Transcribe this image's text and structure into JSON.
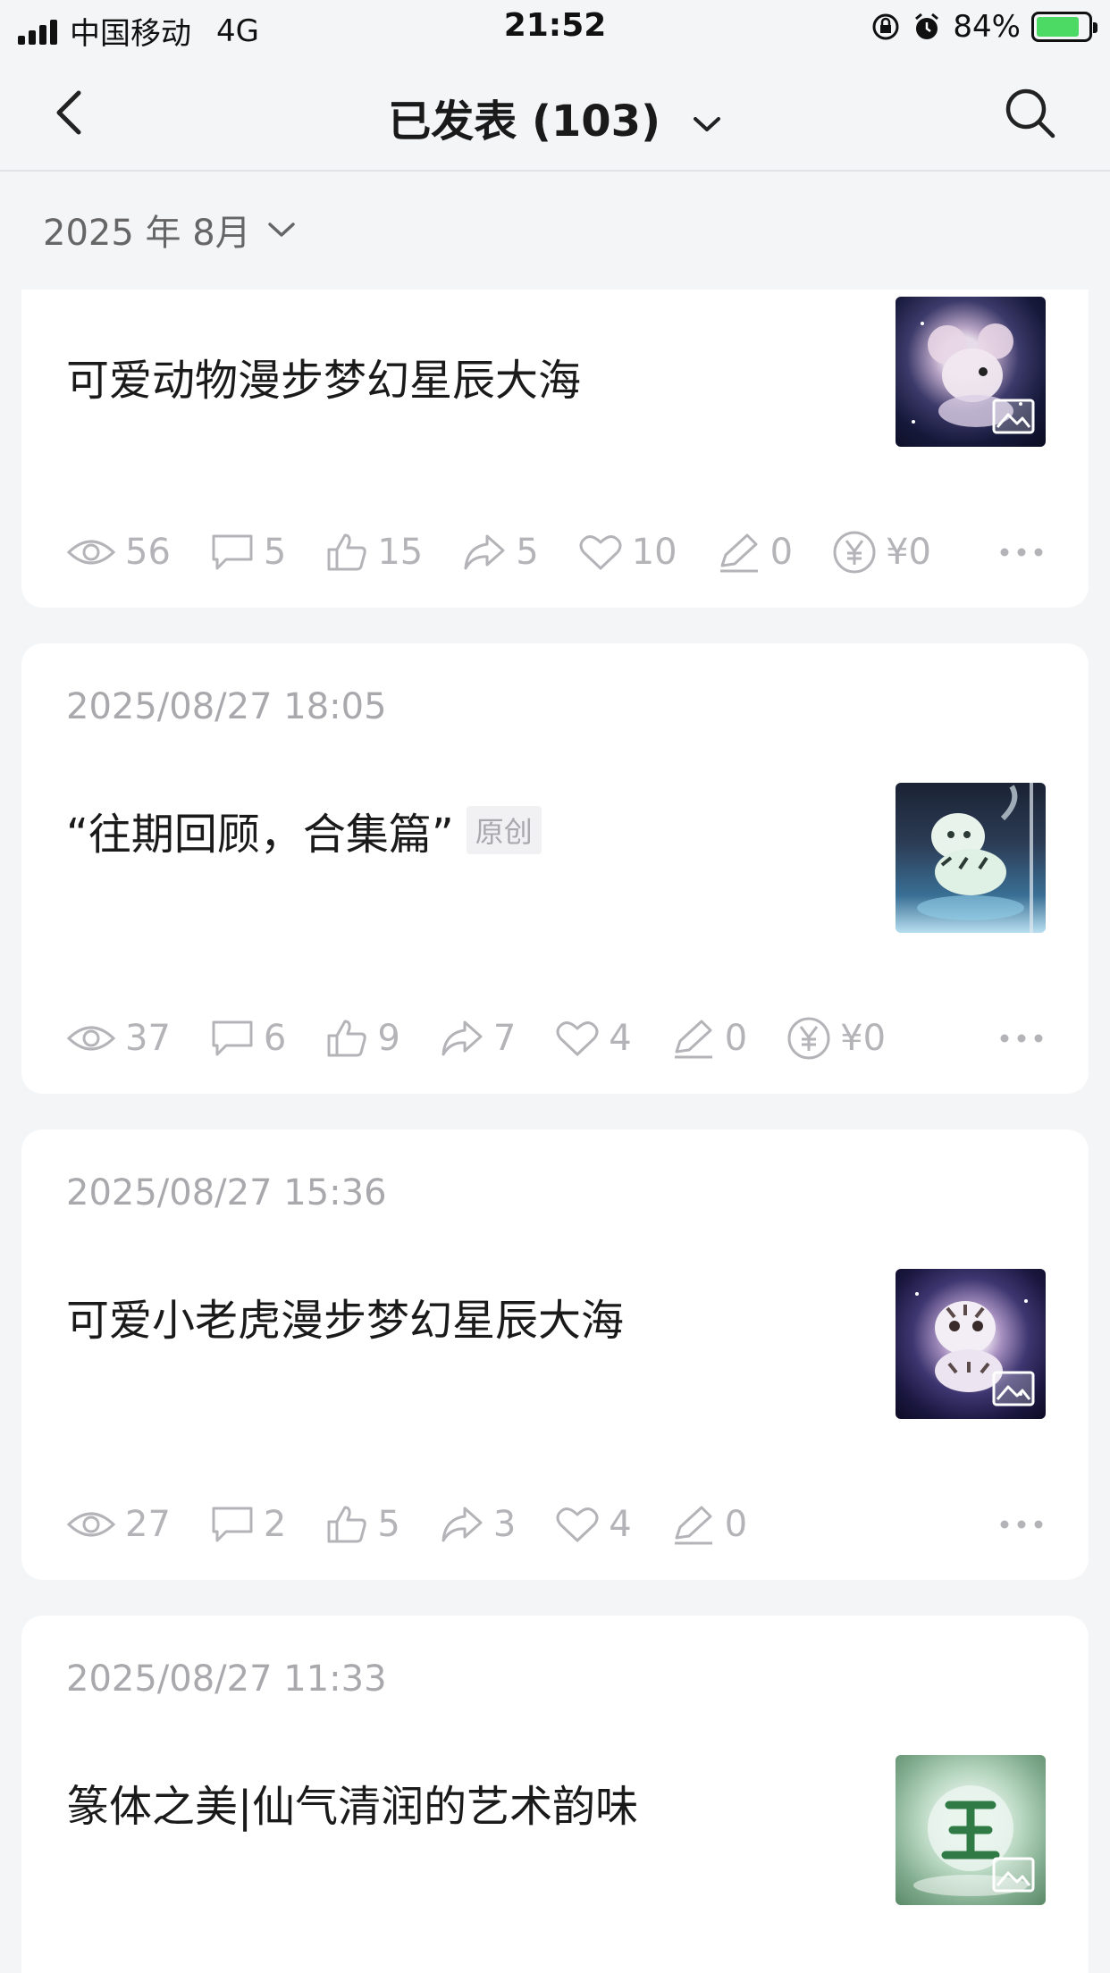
{
  "status_bar": {
    "carrier": "中国移动",
    "network": "4G",
    "time": "21:52",
    "battery": "84%",
    "battery_level": 0.84
  },
  "nav": {
    "title": "已发表 (103)"
  },
  "filter": {
    "month": "2025 年 8月"
  },
  "articles": [
    {
      "date": "",
      "title": "可爱动物漫步梦幻星辰大海",
      "stats": {
        "views": "56",
        "comments": "5",
        "likes": "15",
        "shares": "5",
        "favorites": "10",
        "edits": "0",
        "earnings": "¥0"
      }
    },
    {
      "date": "2025/08/27 18:05",
      "title": "“往期回顾，合集篇”",
      "tag": "原创",
      "stats": {
        "views": "37",
        "comments": "6",
        "likes": "9",
        "shares": "7",
        "favorites": "4",
        "edits": "0",
        "earnings": "¥0"
      }
    },
    {
      "date": "2025/08/27 15:36",
      "title": "可爱小老虎漫步梦幻星辰大海",
      "stats": {
        "views": "27",
        "comments": "2",
        "likes": "5",
        "shares": "3",
        "favorites": "4",
        "edits": "0"
      }
    },
    {
      "date": "2025/08/27 11:33",
      "title": "篆体之美|仙气清润的艺术韵味"
    }
  ]
}
